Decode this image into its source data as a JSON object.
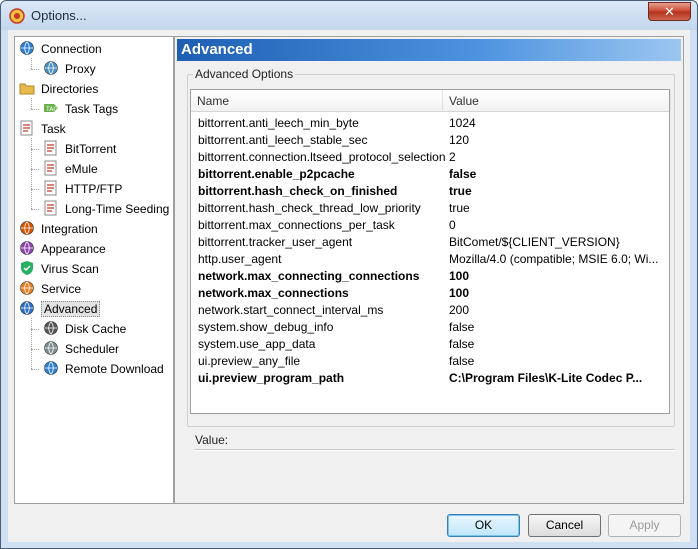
{
  "window": {
    "title": "Options...",
    "close_symbol": "✕"
  },
  "tree": {
    "items": [
      {
        "label": "Connection",
        "icon": "globe-icon"
      },
      {
        "label": "Proxy",
        "icon": "network-icon"
      },
      {
        "label": "Directories",
        "icon": "folder-icon"
      },
      {
        "label": "Task Tags",
        "icon": "tag-icon"
      },
      {
        "label": "Task",
        "icon": "task-icon"
      },
      {
        "label": "BitTorrent",
        "icon": "task-icon"
      },
      {
        "label": "eMule",
        "icon": "task-icon"
      },
      {
        "label": "HTTP/FTP",
        "icon": "task-icon"
      },
      {
        "label": "Long-Time Seeding",
        "icon": "task-icon"
      },
      {
        "label": "Integration",
        "icon": "integration-icon"
      },
      {
        "label": "Appearance",
        "icon": "palette-icon"
      },
      {
        "label": "Virus Scan",
        "icon": "shield-icon"
      },
      {
        "label": "Service",
        "icon": "service-icon"
      },
      {
        "label": "Advanced",
        "icon": "advanced-icon"
      },
      {
        "label": "Disk Cache",
        "icon": "disk-icon"
      },
      {
        "label": "Scheduler",
        "icon": "scheduler-icon"
      },
      {
        "label": "Remote Download",
        "icon": "globe-icon"
      }
    ],
    "selected": "Advanced"
  },
  "panel": {
    "header": "Advanced",
    "group_label": "Advanced Options",
    "columns": {
      "name": "Name",
      "value": "Value"
    },
    "rows": [
      {
        "name": "bittorrent.anti_leech_min_byte",
        "value": "1024",
        "bold": false
      },
      {
        "name": "bittorrent.anti_leech_stable_sec",
        "value": "120",
        "bold": false
      },
      {
        "name": "bittorrent.connection.ltseed_protocol_selection",
        "value": "2",
        "bold": false
      },
      {
        "name": "bittorrent.enable_p2pcache",
        "value": "false",
        "bold": true
      },
      {
        "name": "bittorrent.hash_check_on_finished",
        "value": "true",
        "bold": true
      },
      {
        "name": "bittorrent.hash_check_thread_low_priority",
        "value": "true",
        "bold": false
      },
      {
        "name": "bittorrent.max_connections_per_task",
        "value": "0",
        "bold": false
      },
      {
        "name": "bittorrent.tracker_user_agent",
        "value": "BitComet/${CLIENT_VERSION}",
        "bold": false
      },
      {
        "name": "http.user_agent",
        "value": "Mozilla/4.0 (compatible; MSIE 6.0; Wi...",
        "bold": false
      },
      {
        "name": "network.max_connecting_connections",
        "value": "100",
        "bold": true
      },
      {
        "name": "network.max_connections",
        "value": "100",
        "bold": true
      },
      {
        "name": "network.start_connect_interval_ms",
        "value": "200",
        "bold": false
      },
      {
        "name": "system.show_debug_info",
        "value": "false",
        "bold": false
      },
      {
        "name": "system.use_app_data",
        "value": "false",
        "bold": false
      },
      {
        "name": "ui.preview_any_file",
        "value": "false",
        "bold": false
      },
      {
        "name": "ui.preview_program_path",
        "value": "C:\\Program Files\\K-Lite Codec P...",
        "bold": true
      }
    ],
    "value_label": "Value:"
  },
  "buttons": {
    "ok": "OK",
    "cancel": "Cancel",
    "apply": "Apply"
  }
}
